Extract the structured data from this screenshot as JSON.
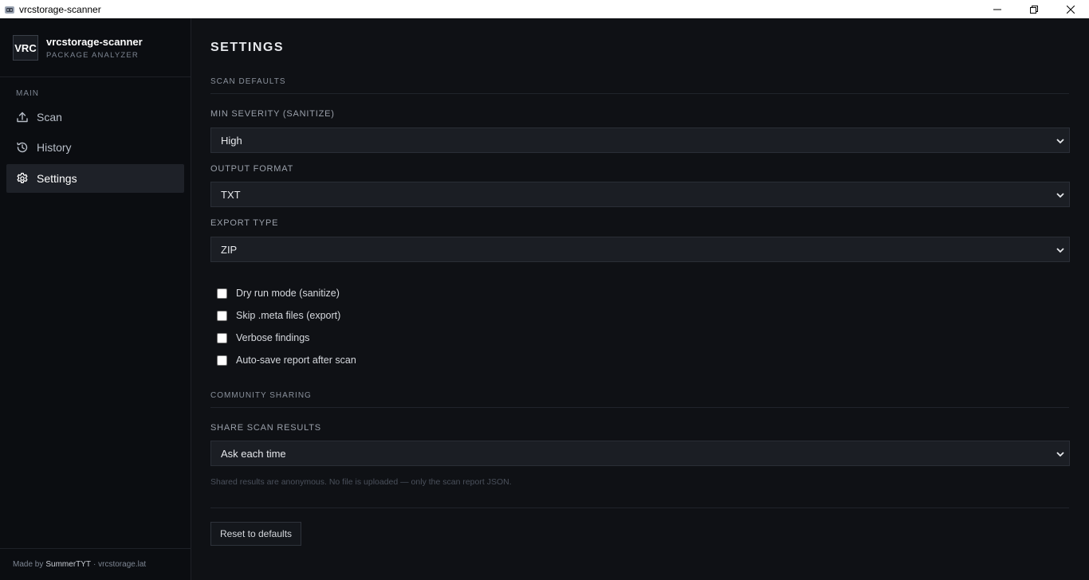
{
  "window": {
    "title": "vrcstorage-scanner",
    "controls": [
      "minimize-icon",
      "restore-icon",
      "close-icon"
    ]
  },
  "sidebar": {
    "brand": {
      "logo_text": "VRC",
      "name": "vrcstorage-scanner",
      "subtitle": "PACKAGE ANALYZER"
    },
    "section_label": "MAIN",
    "items": [
      {
        "label": "Scan",
        "icon": "upload-icon",
        "active": false
      },
      {
        "label": "History",
        "icon": "history-icon",
        "active": false
      },
      {
        "label": "Settings",
        "icon": "gear-icon",
        "active": true
      }
    ],
    "footer": {
      "made_by": "Made by",
      "author": "SummerTYT",
      "site": "· vrcstorage.lat"
    }
  },
  "main": {
    "title": "SETTINGS",
    "scan_defaults": {
      "header": "SCAN DEFAULTS",
      "min_severity": {
        "label": "MIN SEVERITY (SANITIZE)",
        "value": "High"
      },
      "output_format": {
        "label": "OUTPUT FORMAT",
        "value": "TXT"
      },
      "export_type": {
        "label": "EXPORT TYPE",
        "value": "ZIP"
      },
      "checkboxes": [
        {
          "label": "Dry run mode (sanitize)",
          "checked": false
        },
        {
          "label": "Skip .meta files (export)",
          "checked": false
        },
        {
          "label": "Verbose findings",
          "checked": false
        },
        {
          "label": "Auto-save report after scan",
          "checked": false
        }
      ]
    },
    "community": {
      "header": "COMMUNITY SHARING",
      "share_results": {
        "label": "SHARE SCAN RESULTS",
        "value": "Ask each time"
      },
      "hint": "Shared results are anonymous. No file is uploaded — only the scan report JSON."
    },
    "reset_label": "Reset to defaults"
  },
  "colors": {
    "background": "#0f1115",
    "sidebar": "#0b0d11",
    "active_item": "#1e2128",
    "input_bg": "#1b1e24"
  }
}
